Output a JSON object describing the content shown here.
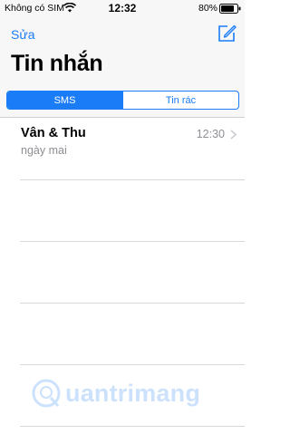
{
  "status_bar": {
    "carrier": "Không có SIM",
    "time": "12:32",
    "battery": "80%",
    "wifi_icon": "wifi-icon",
    "battery_icon": "battery-icon"
  },
  "nav": {
    "edit_label": "Sửa",
    "compose_icon": "compose-icon",
    "title": "Tin nhắn"
  },
  "segments": [
    {
      "label": "SMS",
      "selected": true
    },
    {
      "label": "Tin rác",
      "selected": false
    }
  ],
  "messages": [
    {
      "name": "Vân & Thu",
      "preview": "ngày mai",
      "time": "12:30"
    }
  ],
  "watermark": {
    "text": "uantrimang"
  },
  "colors": {
    "accent": "#1a7cf6",
    "secondary_text": "#8e8e93",
    "separator": "#d9d9dd",
    "bar_bg": "#f7f7f7"
  }
}
